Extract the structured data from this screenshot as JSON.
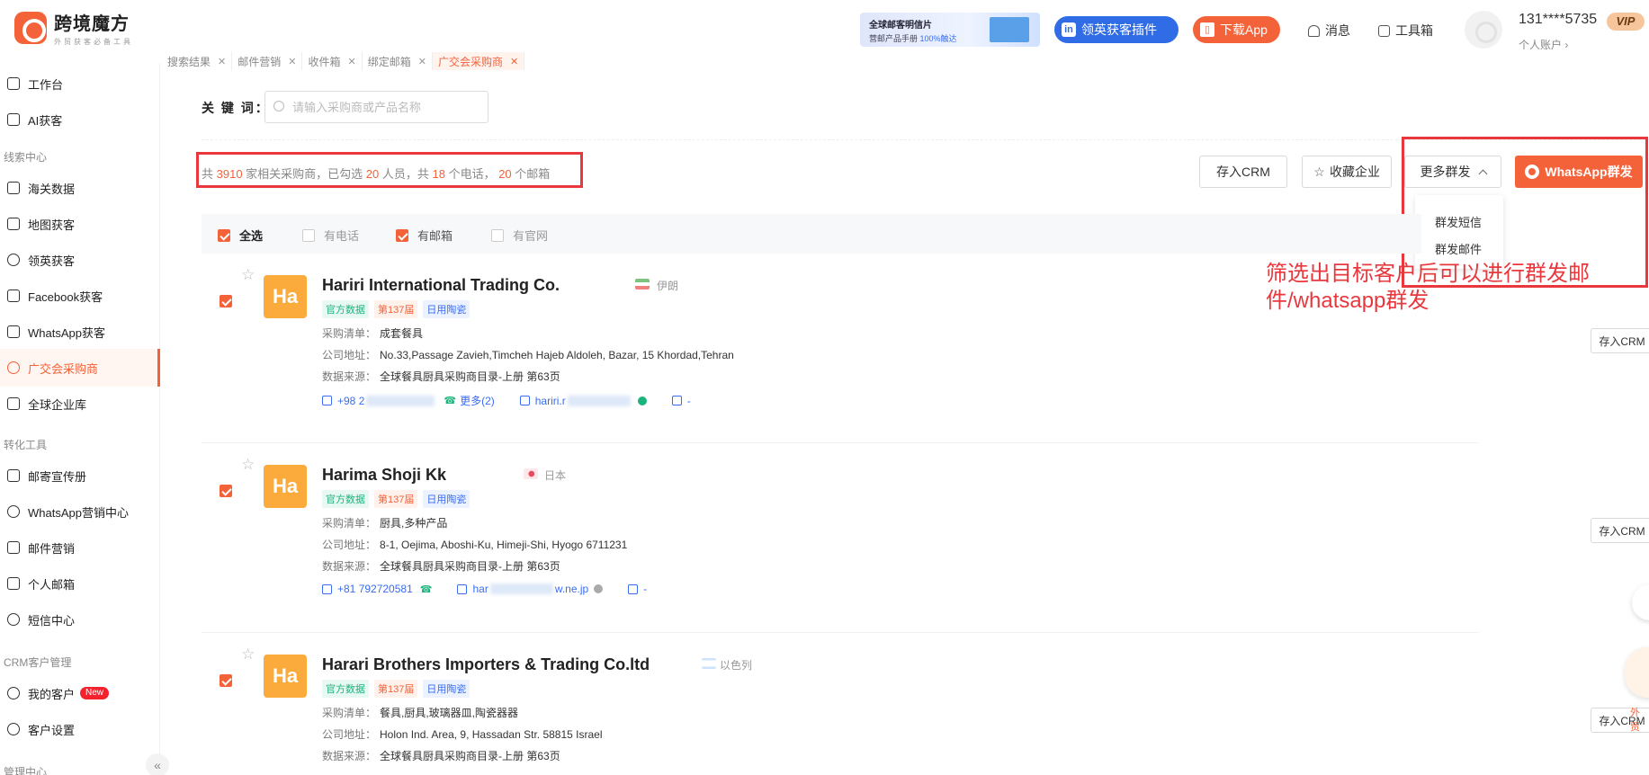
{
  "header": {
    "logo_title": "跨境魔方",
    "logo_sub": "外贸获客必备工具",
    "promo_line1": "全球邮客明信片",
    "promo_line2": "营邮产品手册",
    "promo_highlight": "100%触达",
    "linkedin_label": "领英获客插件",
    "download_label": "下载App",
    "messages_label": "消息",
    "toolbox_label": "工具箱",
    "account_phone": "131****5735",
    "account_sub": "个人账户 ›",
    "vip": "VIP"
  },
  "tabs": [
    {
      "label": "搜索结果"
    },
    {
      "label": "邮件营销"
    },
    {
      "label": "收件箱"
    },
    {
      "label": "绑定邮箱"
    },
    {
      "label": "广交会采购商"
    }
  ],
  "sidebar": {
    "items": [
      {
        "label": "工作台"
      },
      {
        "label": "AI获客"
      },
      {
        "label": "海关数据"
      },
      {
        "label": "地图获客"
      },
      {
        "label": "领英获客"
      },
      {
        "label": "Facebook获客"
      },
      {
        "label": "WhatsApp获客"
      },
      {
        "label": "广交会采购商"
      },
      {
        "label": "全球企业库"
      },
      {
        "label": "邮寄宣传册"
      },
      {
        "label": "WhatsApp营销中心"
      },
      {
        "label": "邮件营销"
      },
      {
        "label": "个人邮箱"
      },
      {
        "label": "短信中心"
      },
      {
        "label": "我的客户"
      },
      {
        "label": "客户设置"
      }
    ],
    "sections": [
      "线索中心",
      "转化工具",
      "CRM客户管理",
      "管理中心"
    ],
    "new_tag": "New"
  },
  "search": {
    "label": "关 键 词：",
    "placeholder": "请输入采购商或产品名称"
  },
  "summary": {
    "p1": "共 ",
    "total": "3910",
    "p2": " 家相关采购商，已勾选 ",
    "selected": "20",
    "p3": " 人员，共 ",
    "phones": "18",
    "p4": " 个电话，",
    "emails": "20",
    "p5": " 个邮箱"
  },
  "actions": {
    "save_crm": "存入CRM",
    "favorite": "收藏企业",
    "more_bulk": "更多群发",
    "whatsapp_bulk": "WhatsApp群发",
    "dropdown": [
      "群发短信",
      "群发邮件"
    ]
  },
  "filters": [
    {
      "label": "全选",
      "checked": true
    },
    {
      "label": "有电话",
      "checked": false
    },
    {
      "label": "有邮箱",
      "checked": true
    },
    {
      "label": "有官网",
      "checked": false
    }
  ],
  "annotation": "筛选出目标客户后可以进行群发邮件/whatsapp群发",
  "field_labels": {
    "purchase": "采购清单：",
    "address": "公司地址：",
    "source": "数据来源："
  },
  "companies": [
    {
      "logo": "Ha",
      "name": "Hariri International Trading Co.",
      "country": "伊朗",
      "tags": [
        "官方数据",
        "第137届",
        "日用陶瓷"
      ],
      "purchase": "成套餐具",
      "address": "No.33,Passage Zavieh,Timcheh Hajeb Aldoleh, Bazar, 15 Khordad,Tehran",
      "source": "全球餐具厨具采购商目录-上册 第63页",
      "phone": "+98 2",
      "more": "更多(2)",
      "email": "hariri.r",
      "website": "-"
    },
    {
      "logo": "Ha",
      "name": "Harima Shoji Kk",
      "country": "日本",
      "tags": [
        "官方数据",
        "第137届",
        "日用陶瓷"
      ],
      "purchase": "厨具,多种产品",
      "address": "8-1, Oejima, Aboshi-Ku, Himeji-Shi, Hyogo 6711231",
      "source": "全球餐具厨具采购商目录-上册 第63页",
      "phone": "+81 792720581",
      "email": "har",
      "email_tail": "w.ne.jp",
      "website": "-"
    },
    {
      "logo": "Ha",
      "name": "Harari Brothers Importers & Trading Co.ltd",
      "country": "以色列",
      "tags": [
        "官方数据",
        "第137届",
        "日用陶瓷"
      ],
      "purchase": "餐具,厨具,玻璃器皿,陶瓷器器",
      "address": "Holon Ind. Area, 9, Hassadan Str. 58815 Israel",
      "source": "全球餐具厨具采购商目录-上册 第63页"
    }
  ],
  "row_crm": "存入CRM",
  "float_label": "外贸",
  "colors": {
    "accent": "#f4623a",
    "annotation": "#e8383d",
    "link": "#3a6cf0",
    "success": "#1db37d"
  }
}
